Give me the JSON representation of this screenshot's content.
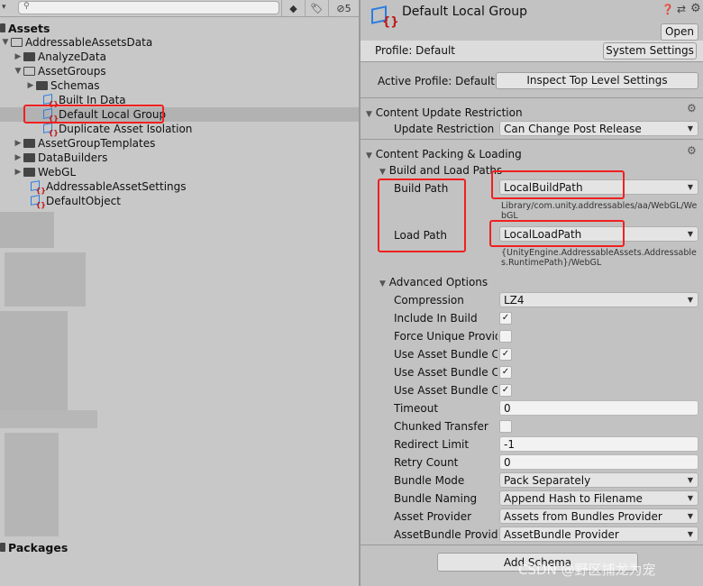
{
  "project": {
    "search": {
      "placeholder": "",
      "icon": "search-icon"
    },
    "toolbar": {
      "hidden_count": "5"
    },
    "root": "Assets",
    "tree": [
      {
        "label": "AddressableAssetsData",
        "type": "folder-open",
        "depth": 0
      },
      {
        "label": "AnalyzeData",
        "type": "folder",
        "depth": 1
      },
      {
        "label": "AssetGroups",
        "type": "folder-open",
        "depth": 1
      },
      {
        "label": "Schemas",
        "type": "folder",
        "depth": 2
      },
      {
        "label": "Built In Data",
        "type": "group",
        "depth": 2
      },
      {
        "label": "Default Local Group",
        "type": "group",
        "depth": 2,
        "selected": true
      },
      {
        "label": "Duplicate Asset Isolation",
        "type": "group",
        "depth": 2
      },
      {
        "label": "AssetGroupTemplates",
        "type": "folder",
        "depth": 1
      },
      {
        "label": "DataBuilders",
        "type": "folder",
        "depth": 1
      },
      {
        "label": "WebGL",
        "type": "folder",
        "depth": 1
      },
      {
        "label": "AddressableAssetSettings",
        "type": "group",
        "depth": 1
      },
      {
        "label": "DefaultObject",
        "type": "group",
        "depth": 1
      }
    ],
    "packages": "Packages"
  },
  "inspector": {
    "title": "Default Local Group",
    "open": "Open",
    "profile": "Profile: Default",
    "system_settings": "System Settings",
    "active_profile": "Active Profile: Default",
    "inspect_top": "Inspect Top Level Settings",
    "content_update": {
      "header": "Content Update Restriction",
      "label": "Update Restriction",
      "value": "Can Change Post Release"
    },
    "packing": {
      "header": "Content Packing & Loading",
      "paths_header": "Build and Load Paths",
      "build_label": "Build Path",
      "build_value": "LocalBuildPath",
      "build_hint": "Library/com.unity.addressables/aa/WebGL/WebGL",
      "load_label": "Load Path",
      "load_value": "LocalLoadPath",
      "load_hint": "{UnityEngine.AddressableAssets.Addressables.RuntimePath}/WebGL",
      "advanced_header": "Advanced Options",
      "fields": [
        {
          "label": "Compression",
          "kind": "dropdown",
          "value": "LZ4"
        },
        {
          "label": "Include In Build",
          "kind": "check",
          "checked": true
        },
        {
          "label": "Force Unique Provider",
          "kind": "check",
          "checked": false
        },
        {
          "label": "Use Asset Bundle Cache",
          "kind": "check",
          "checked": true
        },
        {
          "label": "Use Asset Bundle Crc",
          "kind": "check",
          "checked": true
        },
        {
          "label": "Use Asset Bundle Crc For Cached Bundles",
          "kind": "check",
          "checked": true
        },
        {
          "label": "Timeout",
          "kind": "text",
          "value": "0"
        },
        {
          "label": "Chunked Transfer",
          "kind": "check",
          "checked": false
        },
        {
          "label": "Redirect Limit",
          "kind": "text",
          "value": "-1"
        },
        {
          "label": "Retry Count",
          "kind": "text",
          "value": "0"
        },
        {
          "label": "Bundle Mode",
          "kind": "dropdown",
          "value": "Pack Separately"
        },
        {
          "label": "Bundle Naming",
          "kind": "dropdown",
          "value": "Append Hash to Filename"
        },
        {
          "label": "Asset Provider",
          "kind": "dropdown",
          "value": "Assets from Bundles Provider"
        },
        {
          "label": "AssetBundle Provider",
          "kind": "dropdown",
          "value": "AssetBundle Provider"
        }
      ]
    },
    "add_schema": "Add Schema"
  },
  "watermark": "CSDN @野区捕龙为宠",
  "colors": {
    "highlight": "#f02020",
    "group_icon": "#2a7de1",
    "selection": "#b2b2b2"
  }
}
